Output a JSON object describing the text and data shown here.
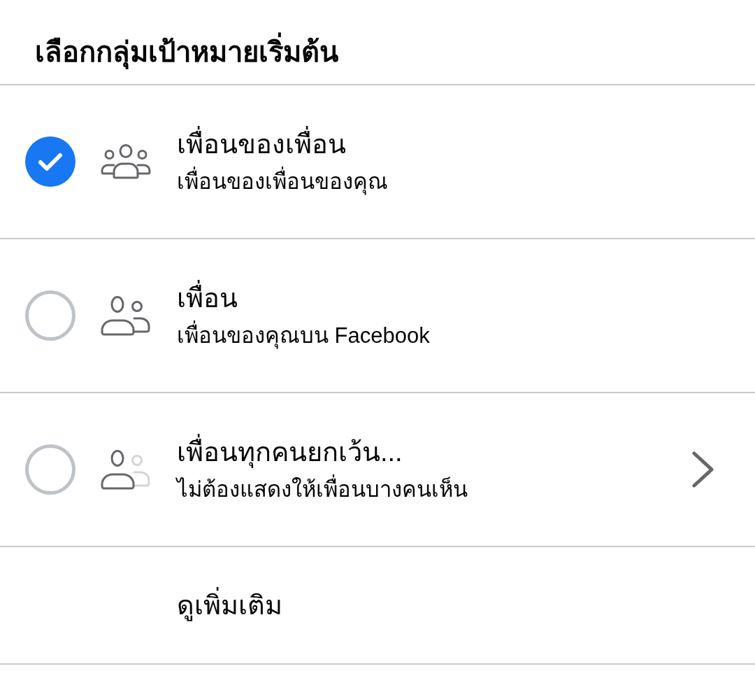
{
  "title": "เลือกกลุ่มเป้าหมายเริ่มต้น",
  "options": [
    {
      "kind": "group",
      "title": "เพื่อนของเพื่อน",
      "subtitle": "เพื่อนของเพื่อนของคุณ",
      "selected": true,
      "chevron": false
    },
    {
      "kind": "pair",
      "title": "เพื่อน",
      "subtitle": "เพื่อนของคุณบน Facebook",
      "selected": false,
      "chevron": false
    },
    {
      "kind": "pair_faded",
      "title": "เพื่อนทุกคนยกเว้น...",
      "subtitle": "ไม่ต้องแสดงให้เพื่อนบางคนเห็น",
      "selected": false,
      "chevron": true
    }
  ],
  "see_more": "ดูเพิ่มเติม"
}
